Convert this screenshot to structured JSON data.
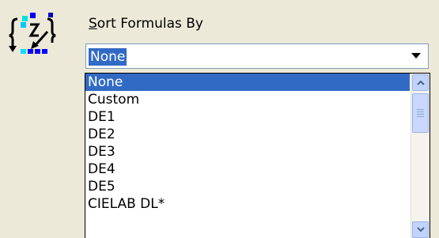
{
  "sort": {
    "label_mnemonic": "S",
    "label_rest": "ort Formulas By",
    "selected_value": "None",
    "options": [
      "None",
      "Custom",
      "DE1",
      "DE2",
      "DE3",
      "DE4",
      "DE5",
      "CIELAB DL*"
    ],
    "highlighted_index": 0
  },
  "icons": {
    "app": "sort-formulas-icon",
    "combo_arrow": "chevron-down-icon",
    "scroll_up": "scroll-up-arrow-icon",
    "scroll_down": "scroll-down-arrow-icon"
  },
  "colors": {
    "window_bg": "#ece9d8",
    "selection": "#316ac5",
    "scroll_accent": "#4d6185"
  }
}
